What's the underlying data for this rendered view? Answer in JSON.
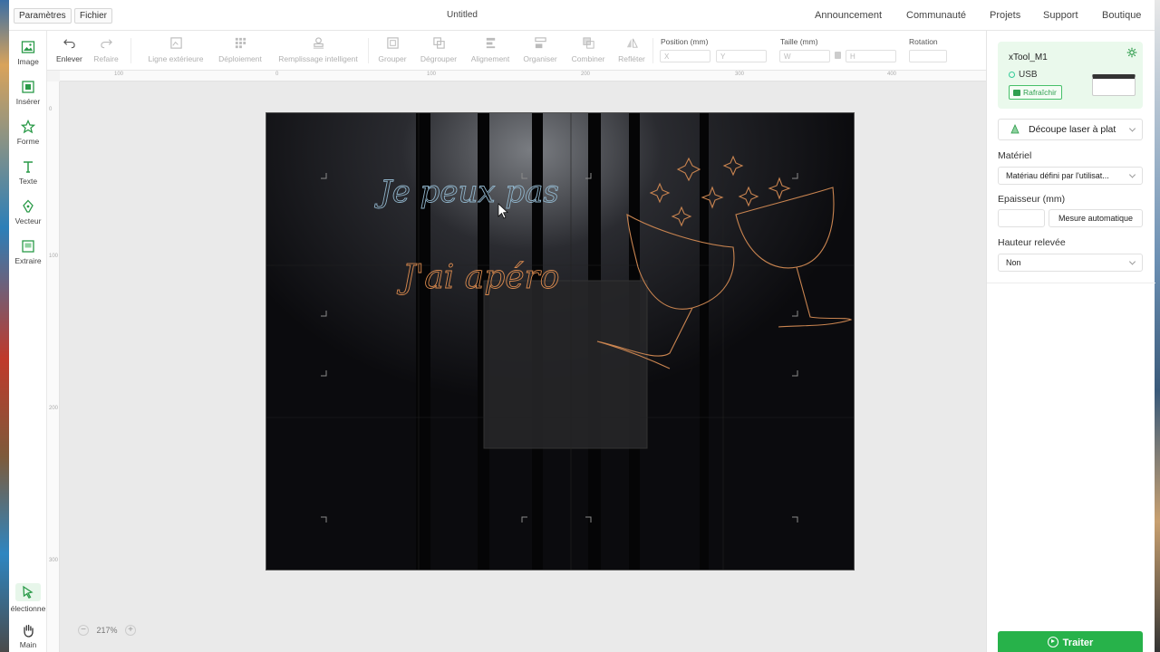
{
  "topbar": {
    "settings_label": "Paramètres",
    "file_label": "Fichier",
    "doc_title": "Untitled",
    "nav": [
      "Announcement",
      "Communauté",
      "Projets",
      "Support",
      "Boutique"
    ]
  },
  "leftbar": {
    "image": "Image",
    "insert": "Insérer",
    "shape": "Forme",
    "text": "Texte",
    "vector": "Vecteur",
    "extract": "Extraire",
    "select": "électionne",
    "hand": "Main"
  },
  "toolbar": {
    "undo": "Enlever",
    "redo": "Refaire",
    "outline": "Ligne extérieure",
    "array": "Déploiement",
    "smart_fill": "Remplissage intelligent",
    "group": "Grouper",
    "ungroup": "Dégrouper",
    "align": "Alignement",
    "arrange": "Organiser",
    "combine": "Combiner",
    "reflect": "Refléter",
    "position_label": "Position (mm)",
    "size_label": "Taille (mm)",
    "rotation_label": "Rotation",
    "x_placeholder": "X",
    "y_placeholder": "Y",
    "w_placeholder": "W",
    "h_placeholder": "H"
  },
  "ruler": {
    "h_ticks": [
      "100",
      "0",
      "100",
      "200",
      "300",
      "400"
    ],
    "v_ticks": [
      "0",
      "100",
      "200",
      "300"
    ]
  },
  "canvas": {
    "text1": "Je peux pas",
    "text2": "J'ai apéro",
    "zoom": "217%"
  },
  "panel": {
    "device_name": "xTool_M1",
    "connection": "USB",
    "refresh_label": "Rafraîchir",
    "mode": "Découpe laser à plat",
    "material_label": "Matériel",
    "material_value": "Matériau défini par l'utilisat...",
    "thickness_label": "Epaisseur (mm)",
    "auto_measure_label": "Mesure automatique",
    "lift_label": "Hauteur relevée",
    "lift_value": "Non",
    "process_label": "Traiter"
  },
  "colors": {
    "accent": "#27b24a",
    "device_card": "#eaf9ec",
    "text1_stroke": "#8fb3c9",
    "text2_stroke": "#d8894e",
    "glasses_stroke": "#c98450"
  }
}
